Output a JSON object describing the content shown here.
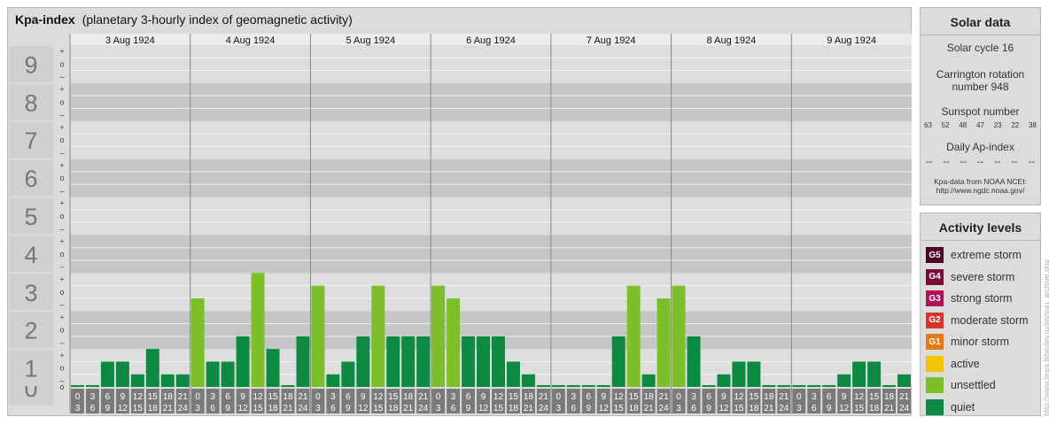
{
  "title": {
    "main": "Kpa-index",
    "sub": "(planetary 3-hourly index of geomagnetic activity)"
  },
  "chart_data": {
    "type": "bar",
    "title": "Kpa-index",
    "subtitle": "(planetary 3-hourly index of geomagnetic activity)",
    "ylim": [
      0,
      9
    ],
    "y_ticks": [
      "0",
      "1",
      "2",
      "3",
      "4",
      "5",
      "6",
      "7",
      "8",
      "9"
    ],
    "minor_ticks": [
      "–",
      "o",
      "+"
    ],
    "days": [
      "3 Aug 1924",
      "4 Aug 1924",
      "5 Aug 1924",
      "6 Aug 1924",
      "7 Aug 1924",
      "8 Aug 1924",
      "9 Aug 1924"
    ],
    "interval_labels": [
      {
        "start": "0",
        "end": "3"
      },
      {
        "start": "3",
        "end": "6"
      },
      {
        "start": "6",
        "end": "9"
      },
      {
        "start": "9",
        "end": "12"
      },
      {
        "start": "12",
        "end": "15"
      },
      {
        "start": "15",
        "end": "18"
      },
      {
        "start": "18",
        "end": "21"
      },
      {
        "start": "21",
        "end": "24"
      }
    ],
    "values": [
      0,
      0,
      0.667,
      0.667,
      0.333,
      1,
      0.333,
      0.333,
      2.333,
      0.667,
      0.667,
      1.333,
      3,
      1,
      0,
      1.333,
      2.667,
      0.333,
      0.667,
      1.333,
      2.667,
      1.333,
      1.333,
      1.333,
      2.667,
      2.333,
      1.333,
      1.333,
      1.333,
      0.667,
      0.333,
      0,
      0,
      0,
      0,
      0,
      1.333,
      2.667,
      0.333,
      2.333,
      2.667,
      1.333,
      0,
      0.333,
      0.667,
      0.667,
      0,
      0,
      0,
      0,
      0,
      0.333,
      0.667,
      0.667,
      0,
      0.333
    ],
    "grid": true,
    "colors": {
      "quiet": "#0b8a40",
      "unsettled": "#7cbf2a",
      "band_dark": "#c6c6c6",
      "band_light": "#dedede",
      "axis_cell": "#7a7a7a"
    }
  },
  "solar": {
    "heading": "Solar data",
    "cycle": "Solar cycle 16",
    "carrington_1": "Carrington rotation",
    "carrington_2": "number 948",
    "sunspot_heading": "Sunspot number",
    "sunspots": [
      "63",
      "52",
      "48",
      "47",
      "23",
      "22",
      "38"
    ],
    "ap_heading": "Daily Ap-index",
    "ap_values": [
      "--",
      "--",
      "--",
      "--",
      "--",
      "--",
      "--"
    ],
    "source_1": "Kpa-data from NOAA NCEI:",
    "source_2": "http://www.ngdc.noaa.gov/"
  },
  "activity": {
    "heading": "Activity levels",
    "levels": [
      {
        "badge": "G5",
        "label": "extreme storm",
        "color": "#4b0024"
      },
      {
        "badge": "G4",
        "label": "severe storm",
        "color": "#7a0a3a"
      },
      {
        "badge": "G3",
        "label": "strong storm",
        "color": "#b0105a"
      },
      {
        "badge": "G2",
        "label": "moderate storm",
        "color": "#d6332b"
      },
      {
        "badge": "G1",
        "label": "minor storm",
        "color": "#e57a17"
      },
      {
        "badge": "",
        "label": "active",
        "color": "#f5c400"
      },
      {
        "badge": "",
        "label": "unsettled",
        "color": "#7cbf2a"
      },
      {
        "badge": "",
        "label": "quiet",
        "color": "#0b8a40"
      }
    ]
  },
  "watermark": "http://www.tesis.lebedev.ru/en/sun_archive.php"
}
